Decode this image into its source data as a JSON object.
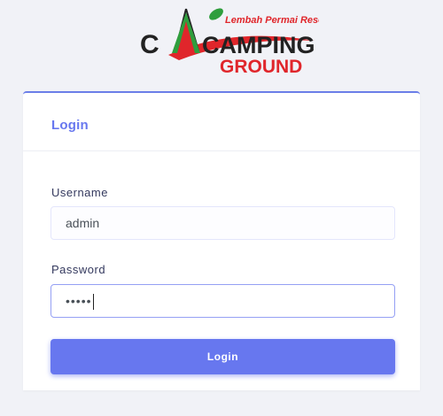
{
  "logo": {
    "brand_main": "CAMPING",
    "brand_sub": "GROUND",
    "tagline": "Lembah Permai Resort",
    "colors": {
      "dark": "#222222",
      "red": "#e0262b",
      "green": "#2f9e3d"
    }
  },
  "login_card": {
    "title": "Login",
    "username_label": "Username",
    "username_value": "admin",
    "password_label": "Password",
    "password_mask": "•••••",
    "button_label": "Login",
    "accent_color": "#6777ef"
  }
}
